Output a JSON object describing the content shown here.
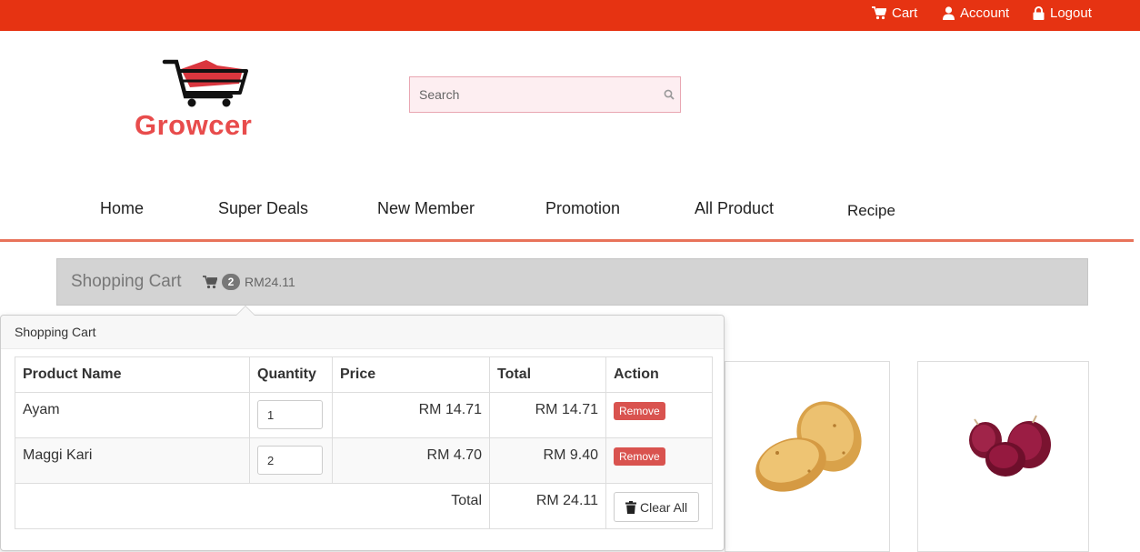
{
  "topbar": {
    "cart_label": "Cart",
    "account_label": "Account",
    "logout_label": "Logout",
    "color": "#e63312"
  },
  "brand": {
    "name": "Growcer",
    "color": "#e84c4c"
  },
  "search": {
    "placeholder": "Search"
  },
  "nav": {
    "items": [
      "Home",
      "Super Deals",
      "New Member",
      "Promotion",
      "All Product",
      "Recipe"
    ]
  },
  "cart_bar": {
    "title": "Shopping Cart",
    "count": "2",
    "total": "RM24.11"
  },
  "popover": {
    "title": "Shopping Cart",
    "columns": [
      "Product Name",
      "Quantity",
      "Price",
      "Total",
      "Action"
    ],
    "rows": [
      {
        "name": "Ayam",
        "quantity": "1",
        "price": "RM 14.71",
        "total": "RM 14.71",
        "action": "Remove"
      },
      {
        "name": "Maggi Kari",
        "quantity": "2",
        "price": "RM 4.70",
        "total": "RM 9.40",
        "action": "Remove"
      }
    ],
    "total_label": "Total",
    "grand_total": "RM 24.11",
    "clear_label": "Clear All"
  },
  "colors": {
    "remove": "#d9534f",
    "accent_line": "#e8735a"
  }
}
